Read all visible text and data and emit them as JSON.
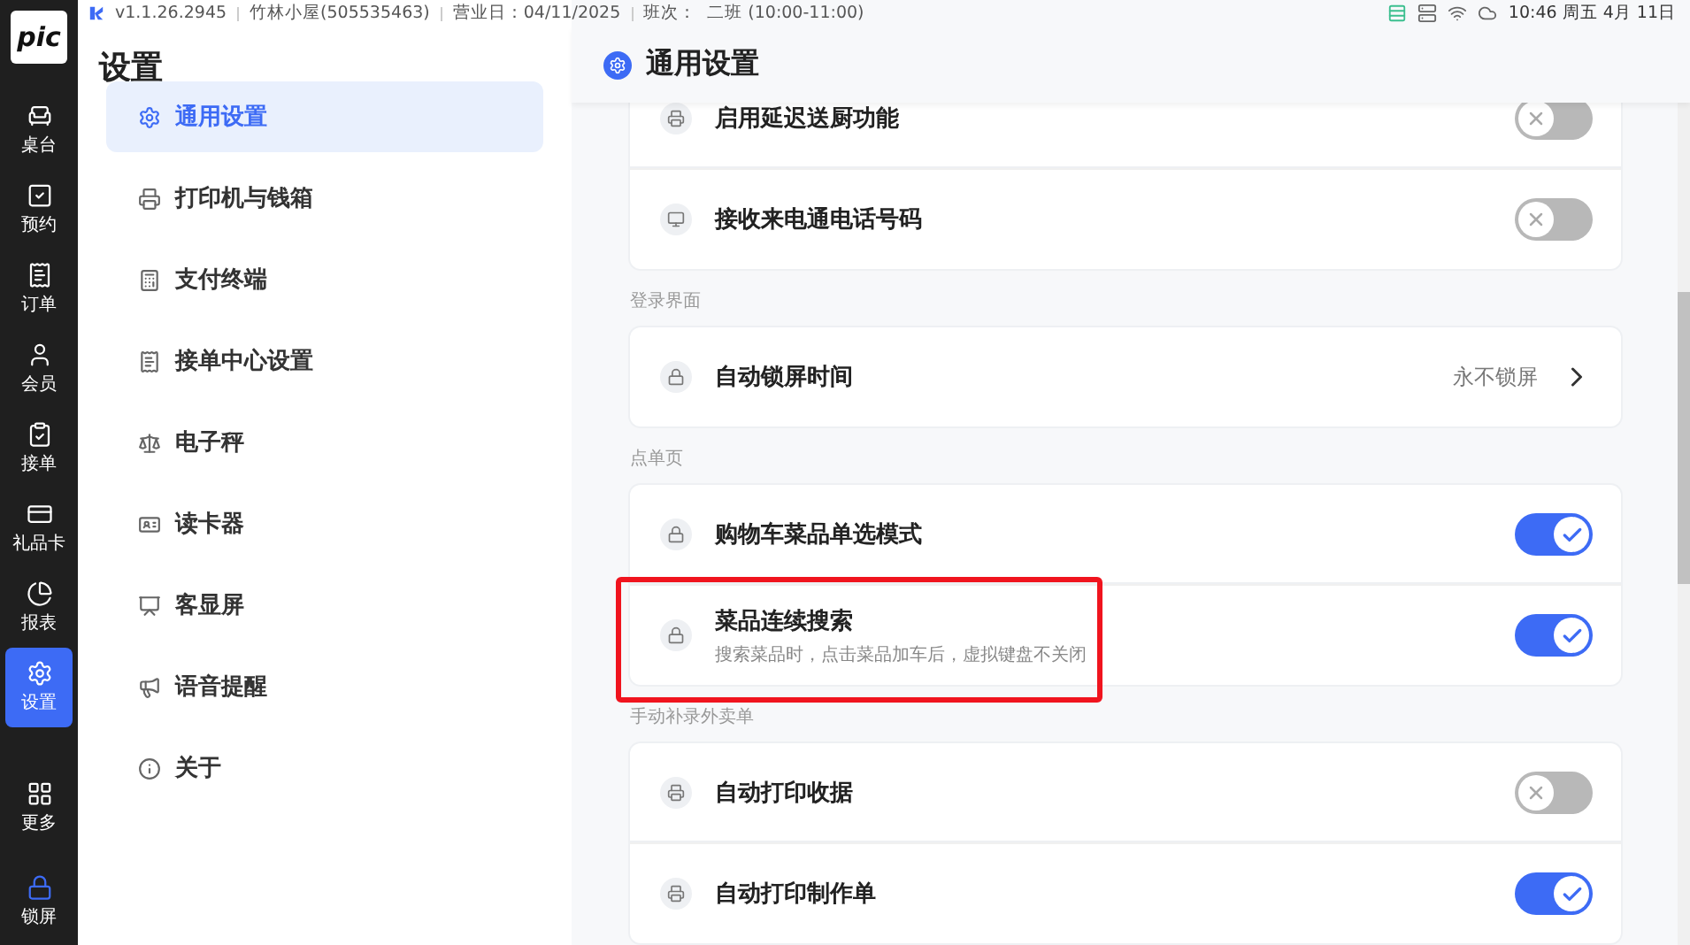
{
  "app_logo": "pic",
  "top_bar": {
    "version": "v1.1.26.2945",
    "store": "竹林小屋(505535463)",
    "business_day": "营业日：04/11/2025",
    "shift_label": "班次：",
    "shift": "二班 (10:00-11:00)",
    "clock": "10:46 周五 4月 11日"
  },
  "nav_rail": {
    "items": [
      {
        "label": "桌台",
        "selected": false
      },
      {
        "label": "预约",
        "selected": false
      },
      {
        "label": "订单",
        "selected": false
      },
      {
        "label": "会员",
        "selected": false
      },
      {
        "label": "接单",
        "selected": false
      },
      {
        "label": "礼品卡",
        "selected": false
      },
      {
        "label": "报表",
        "selected": false
      },
      {
        "label": "设置",
        "selected": true
      }
    ],
    "bottom": [
      {
        "label": "更多",
        "selected": false
      },
      {
        "label": "锁屏",
        "selected": false
      }
    ]
  },
  "settings_menu": {
    "title": "设置",
    "items": [
      {
        "label": "通用设置",
        "selected": true
      },
      {
        "label": "打印机与钱箱",
        "selected": false
      },
      {
        "label": "支付终端",
        "selected": false
      },
      {
        "label": "接单中心设置",
        "selected": false
      },
      {
        "label": "电子秤",
        "selected": false
      },
      {
        "label": "读卡器",
        "selected": false
      },
      {
        "label": "客显屏",
        "selected": false
      },
      {
        "label": "语音提醒",
        "selected": false
      },
      {
        "label": "关于",
        "selected": false
      }
    ]
  },
  "panel": {
    "title": "通用设置",
    "groups": [
      {
        "rows": [
          {
            "kind": "toggle",
            "title": "启用延迟送厨功能",
            "on": false,
            "highlighted": false
          },
          {
            "kind": "toggle",
            "title": "接收来电通电话号码",
            "on": false,
            "highlighted": false
          }
        ]
      },
      {
        "label": "登录界面",
        "rows": [
          {
            "kind": "link",
            "title": "自动锁屏时间",
            "value": "永不锁屏",
            "highlighted": false
          }
        ]
      },
      {
        "label": "点单页",
        "rows": [
          {
            "kind": "toggle",
            "title": "购物车菜品单选模式",
            "on": true,
            "highlighted": false
          },
          {
            "kind": "toggle",
            "title": "菜品连续搜索",
            "description": "搜索菜品时，点击菜品加车后，虚拟键盘不关闭",
            "on": true,
            "highlighted": true
          }
        ]
      },
      {
        "label": "手动补录外卖单",
        "rows": [
          {
            "kind": "toggle",
            "title": "自动打印收据",
            "on": false,
            "highlighted": false
          },
          {
            "kind": "toggle",
            "title": "自动打印制作单",
            "on": true,
            "highlighted": false
          }
        ]
      }
    ]
  }
}
